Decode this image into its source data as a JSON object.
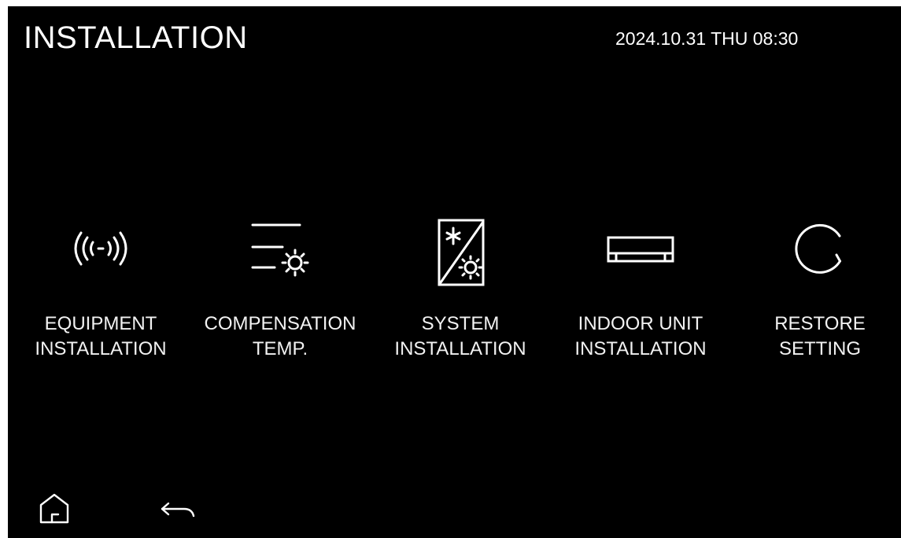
{
  "header": {
    "title": "INSTALLATION",
    "datetime": "2024.10.31 THU 08:30"
  },
  "menu": [
    {
      "icon": "signal-wave-icon",
      "line1": "EQUIPMENT",
      "line2": "INSTALLATION"
    },
    {
      "icon": "compensation-temp-icon",
      "line1": "COMPENSATION",
      "line2": "TEMP."
    },
    {
      "icon": "system-installation-icon",
      "line1": "SYSTEM",
      "line2": "INSTALLATION"
    },
    {
      "icon": "indoor-unit-icon",
      "line1": "INDOOR UNIT",
      "line2": "INSTALLATION"
    },
    {
      "icon": "restore-icon",
      "line1": "RESTORE",
      "line2": "SETTING"
    }
  ],
  "footer": {
    "home_icon": "home-icon",
    "back_icon": "back-arrow-icon"
  },
  "colors": {
    "background": "#000000",
    "foreground": "#ffffff"
  }
}
